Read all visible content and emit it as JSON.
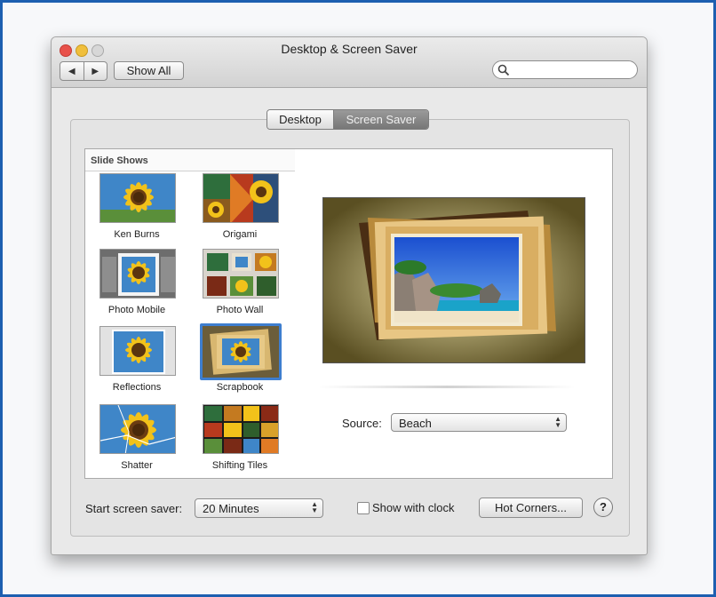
{
  "window": {
    "title": "Desktop & Screen Saver",
    "show_all_label": "Show All",
    "back_glyph": "◀",
    "forward_glyph": "▶",
    "search_placeholder": ""
  },
  "tabs": [
    {
      "label": "Desktop",
      "selected": false
    },
    {
      "label": "Screen Saver",
      "selected": true
    }
  ],
  "slideshows": {
    "header": "Slide Shows",
    "items": [
      {
        "label": "Ken Burns"
      },
      {
        "label": "Origami"
      },
      {
        "label": "Photo Mobile"
      },
      {
        "label": "Photo Wall"
      },
      {
        "label": "Reflections"
      },
      {
        "label": "Scrapbook",
        "selected": true
      },
      {
        "label": "Shatter"
      },
      {
        "label": "Shifting Tiles"
      }
    ]
  },
  "preview": {
    "source_label": "Source:",
    "source_value": "Beach"
  },
  "bottom": {
    "start_label": "Start screen saver:",
    "start_value": "20 Minutes",
    "clock_label": "Show with clock",
    "clock_checked": false,
    "hot_corners_label": "Hot Corners...",
    "help_label": "?"
  },
  "colors": {
    "selection_border": "#3e7ecf",
    "frame_border": "#1d5fb0",
    "segment_selected": "#777777"
  }
}
